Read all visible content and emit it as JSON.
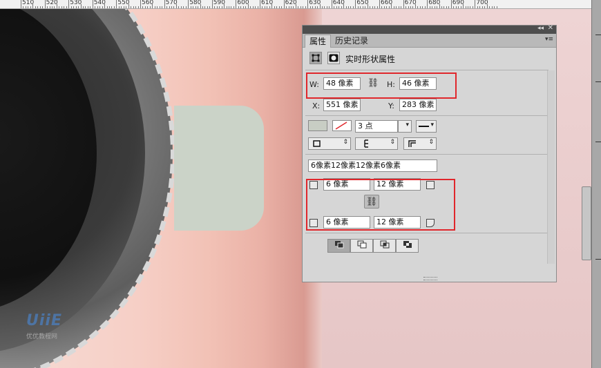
{
  "ruler": {
    "labels": [
      "510",
      "520",
      "530",
      "540",
      "550",
      "560",
      "570",
      "580",
      "590",
      "600",
      "610",
      "620",
      "630",
      "640",
      "650",
      "660",
      "670",
      "680",
      "690",
      "700"
    ]
  },
  "watermark": {
    "logo": "UiiE",
    "sub": "优优教程网"
  },
  "panel": {
    "tabs": [
      "属性",
      "历史记录"
    ],
    "title": "实时形状属性",
    "w_label": "W:",
    "w_value": "48 像素",
    "h_label": "H:",
    "h_value": "46 像素",
    "x_label": "X:",
    "x_value": "551 像素",
    "y_label": "Y:",
    "y_value": "283 像素",
    "stroke_width": "3 点",
    "radius_summary": "6像素12像素12像素6像素",
    "corner_tl": "6 像素",
    "corner_tr": "12 像素",
    "corner_bl": "6 像素",
    "corner_br": "12 像素",
    "fill_color": "#c8cdc4",
    "link_icon": "chain-link-icon"
  },
  "colors": {
    "highlight": "#e0262b"
  }
}
